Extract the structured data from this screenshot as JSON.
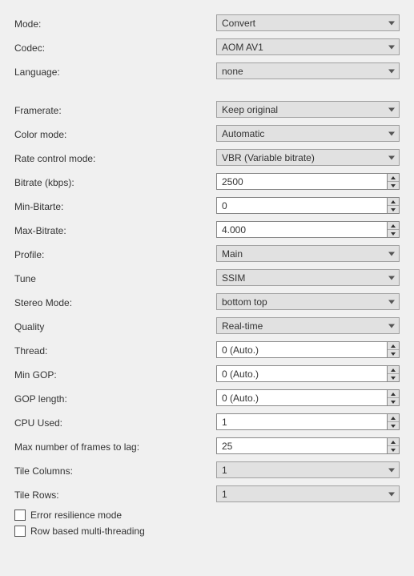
{
  "rows": {
    "mode": {
      "label": "Mode:",
      "value": "Convert"
    },
    "codec": {
      "label": "Codec:",
      "value": "AOM AV1"
    },
    "language": {
      "label": "Language:",
      "value": "none"
    },
    "framerate": {
      "label": "Framerate:",
      "value": "Keep original"
    },
    "colormode": {
      "label": "Color mode:",
      "value": "Automatic"
    },
    "ratectrl": {
      "label": "Rate control mode:",
      "value": "VBR (Variable bitrate)"
    },
    "bitrate": {
      "label": "Bitrate (kbps):",
      "value": "2500"
    },
    "minbr": {
      "label": "Min-Bitarte:",
      "value": "0"
    },
    "maxbr": {
      "label": "Max-Bitrate:",
      "value": "4.000"
    },
    "profile": {
      "label": "Profile:",
      "value": "Main"
    },
    "tune": {
      "label": "Tune",
      "value": "SSIM"
    },
    "stereo": {
      "label": "Stereo Mode:",
      "value": "bottom top"
    },
    "quality": {
      "label": "Quality",
      "value": "Real-time"
    },
    "thread": {
      "label": "Thread:",
      "value": "0 (Auto.)"
    },
    "mingop": {
      "label": "Min GOP:",
      "value": "0 (Auto.)"
    },
    "goplen": {
      "label": "GOP length:",
      "value": "0 (Auto.)"
    },
    "cpuused": {
      "label": "CPU Used:",
      "value": "1"
    },
    "lagframes": {
      "label": "Max number of frames to lag:",
      "value": "25"
    },
    "tilecols": {
      "label": "Tile Columns:",
      "value": "1"
    },
    "tilerows": {
      "label": "Tile Rows:",
      "value": "1"
    }
  },
  "checks": {
    "err": {
      "label": "Error resilience mode"
    },
    "rowmt": {
      "label": "Row based multi-threading"
    }
  }
}
